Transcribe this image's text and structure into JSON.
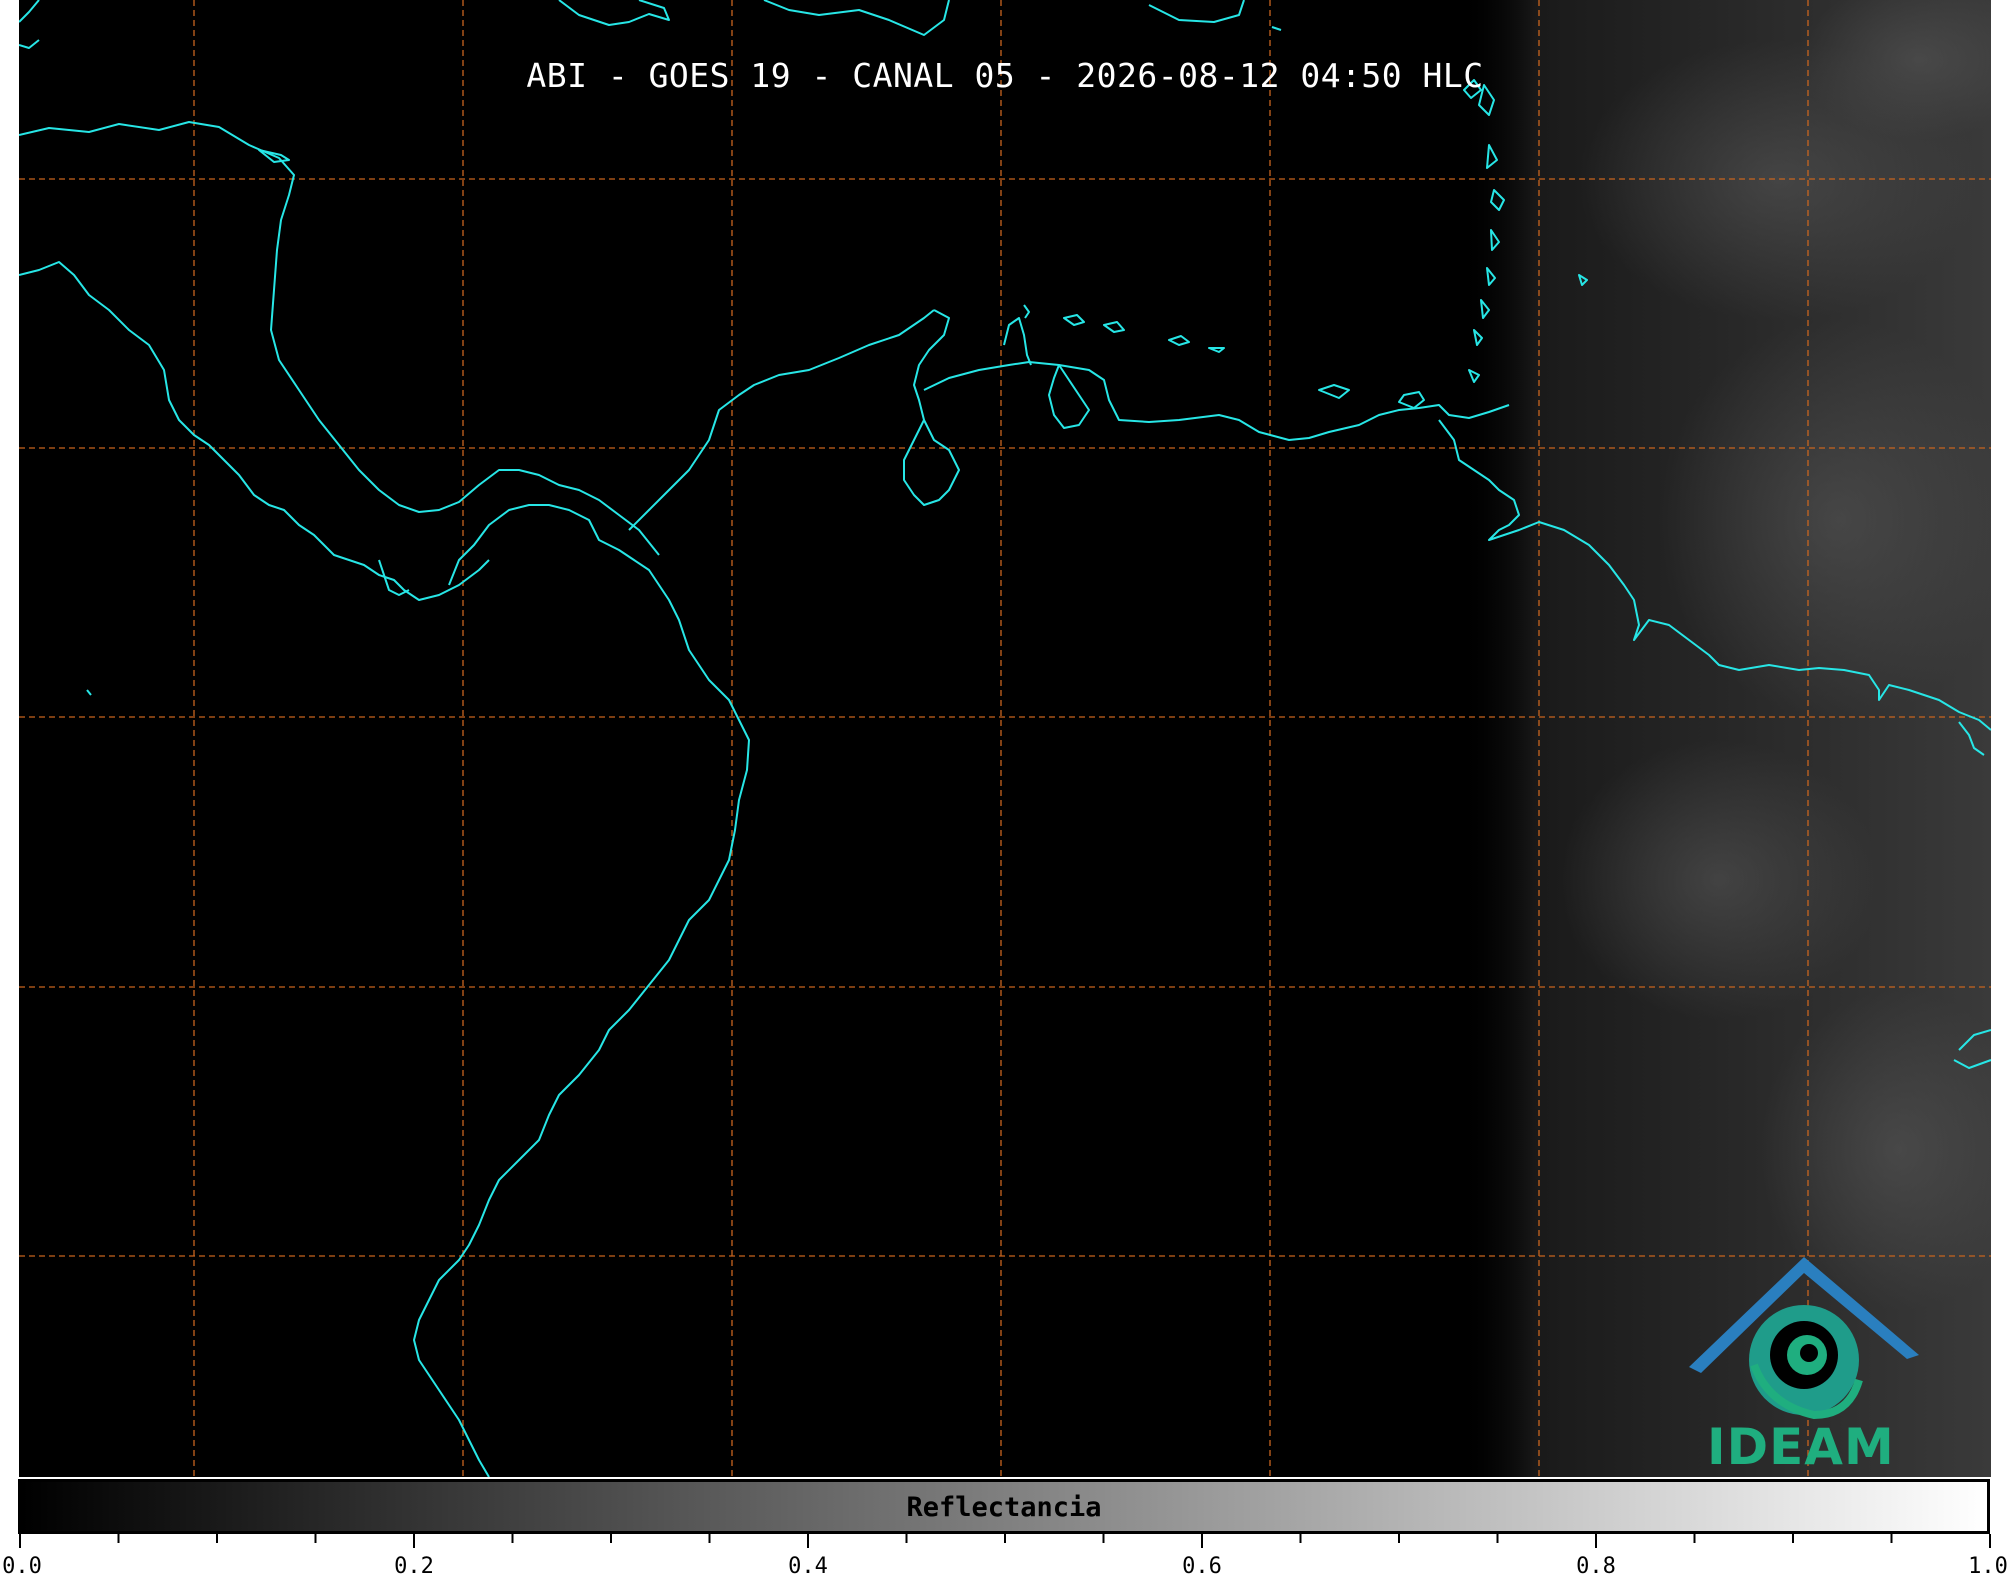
{
  "title": "ABI - GOES 19 - CANAL 05 - 2026-08-12 04:50 HLC",
  "logo": {
    "text": "IDEAM",
    "icon": "ideam-logo-icon"
  },
  "colorbar": {
    "label": "Reflectancia",
    "colormap": "grayscale",
    "min": 0.0,
    "max": 1.0,
    "tick_labels": [
      "0.0",
      "0.2",
      "0.4",
      "0.6",
      "0.8",
      "1.0"
    ]
  },
  "map": {
    "graticule_style": "dashed",
    "colors": {
      "background": "#000000",
      "coastline": "#27e6e6",
      "graticule": "#c8641e",
      "logo_blue": "#2a7fbf",
      "logo_green": "#1fae7f"
    }
  }
}
